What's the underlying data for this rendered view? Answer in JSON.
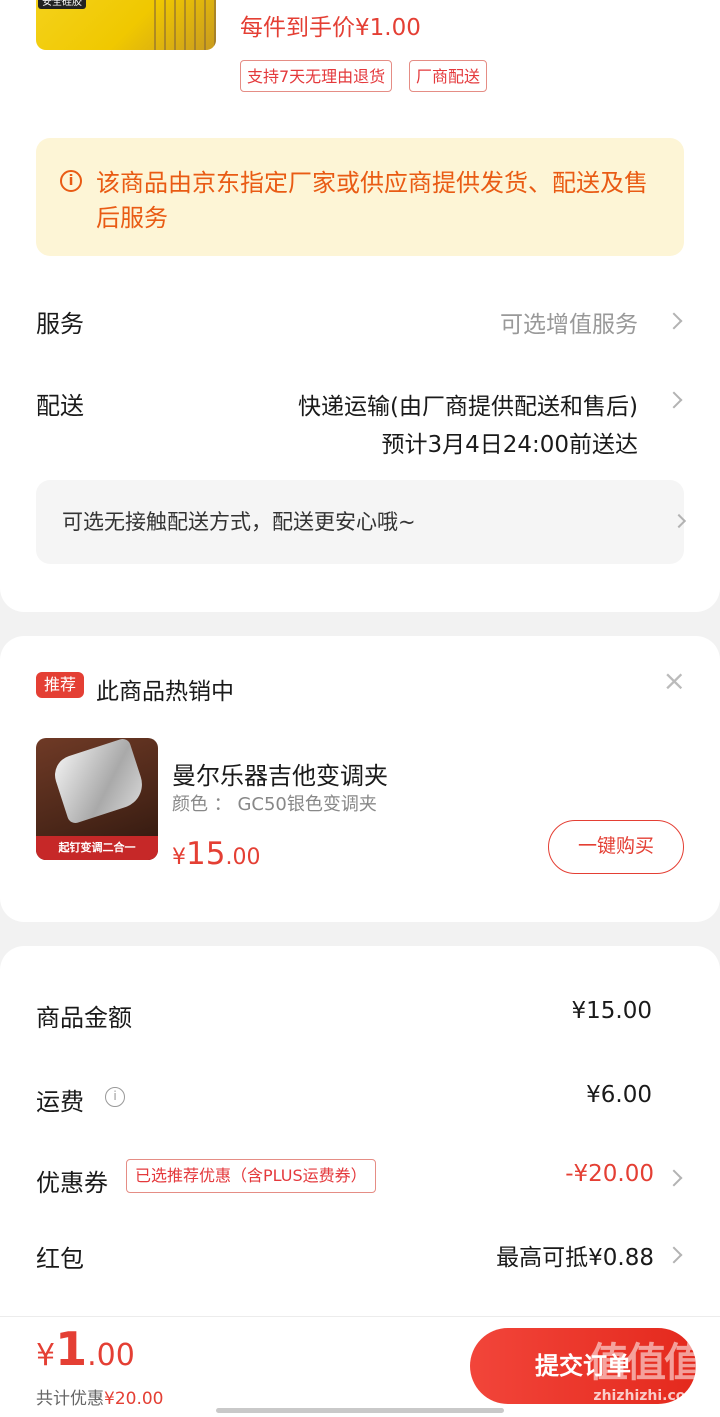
{
  "top_item": {
    "image_tag": "安全硅胶",
    "each_price": "每件到手价¥1.00",
    "chips": [
      "支持7天无理由退货",
      "厂商配送"
    ]
  },
  "notice": {
    "text": "该商品由京东指定厂家或供应商提供发货、配送及售后服务"
  },
  "service": {
    "label": "服务",
    "value": "可选增值服务"
  },
  "delivery": {
    "label": "配送",
    "method": "快递运输(由厂商提供配送和售后)",
    "eta": "预计3月4日24:00前送达"
  },
  "contactless": {
    "text": "可选无接触配送方式，配送更安心哦~"
  },
  "recommend": {
    "badge": "推荐",
    "title": "此商品热销中",
    "close": "×",
    "product": {
      "image_caption": "起钉变调二合一",
      "name": "曼尔乐器吉他变调夹",
      "variant": "颜色 ： GC50银色变调夹",
      "price_symbol": "¥",
      "price_int": "15",
      "price_dec": ".00",
      "buy_label": "一键购买"
    }
  },
  "summary": {
    "goods": {
      "label": "商品金额",
      "value": "¥15.00"
    },
    "shipping": {
      "label": "运费",
      "value": "¥6.00"
    },
    "coupon": {
      "label": "优惠券",
      "tag": "已选推荐优惠（含PLUS运费券）",
      "value": "-¥20.00"
    },
    "redpacket": {
      "label": "红包",
      "value": "最高可抵¥0.88"
    }
  },
  "bottom": {
    "price_symbol": "¥",
    "price_int": "1",
    "price_dec": ".00",
    "discount_label": "共计优惠",
    "discount_amount": "¥20.00",
    "submit_label": "提交订单",
    "watermark": "值值值",
    "watermark_domain": "zhizhizhi.com"
  },
  "colors": {
    "accent": "#e43f34",
    "notice_bg": "#fdf5d6",
    "notice_text": "#e95b14",
    "page_bg": "#f2f2f2"
  }
}
